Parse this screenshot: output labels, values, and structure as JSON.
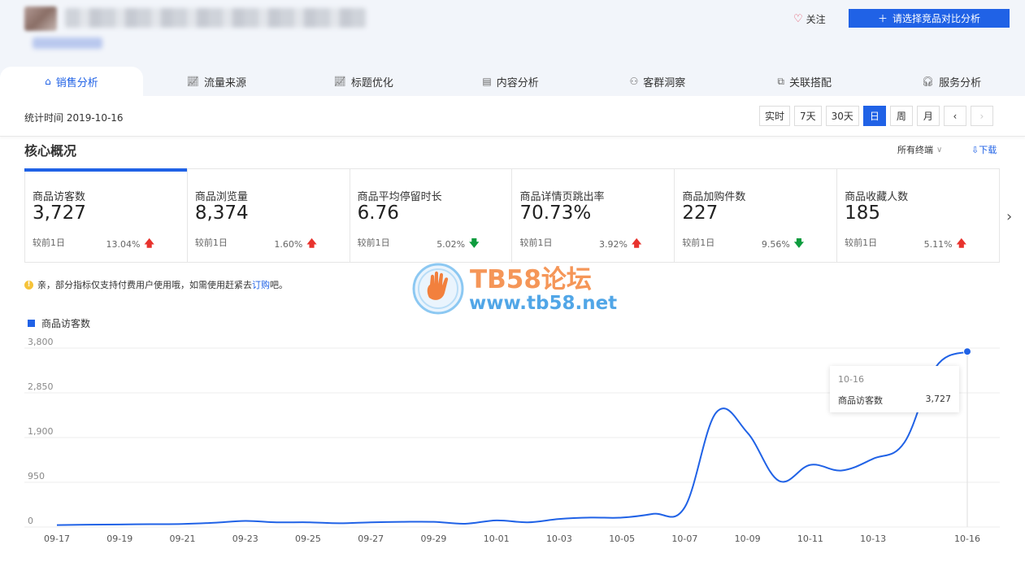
{
  "header": {
    "follow_label": "关注",
    "compare_button": "请选择竞品对比分析"
  },
  "tabs": [
    {
      "label": "销售分析",
      "icon": "bag-icon"
    },
    {
      "label": "流量来源",
      "icon": "line-chart-icon"
    },
    {
      "label": "标题优化",
      "icon": "line-chart-icon"
    },
    {
      "label": "内容分析",
      "icon": "document-icon"
    },
    {
      "label": "客群洞察",
      "icon": "users-icon"
    },
    {
      "label": "关联搭配",
      "icon": "link-icon"
    },
    {
      "label": "服务分析",
      "icon": "headset-icon"
    }
  ],
  "datebar": {
    "stat_time": "统计时间 2019-10-16",
    "ranges": [
      "实时",
      "7天",
      "30天",
      "日",
      "周",
      "月"
    ],
    "active_range": "日"
  },
  "core": {
    "title": "核心概况",
    "terminal": "所有终端",
    "download": "下载",
    "cards": [
      {
        "label": "商品访客数",
        "value": "3,727",
        "compare": "较前1日",
        "pct": "13.04%",
        "trend": "up"
      },
      {
        "label": "商品浏览量",
        "value": "8,374",
        "compare": "较前1日",
        "pct": "1.60%",
        "trend": "up"
      },
      {
        "label": "商品平均停留时长",
        "value": "6.76",
        "compare": "较前1日",
        "pct": "5.02%",
        "trend": "down"
      },
      {
        "label": "商品详情页跳出率",
        "value": "70.73%",
        "compare": "较前1日",
        "pct": "3.92%",
        "trend": "up"
      },
      {
        "label": "商品加购件数",
        "value": "227",
        "compare": "较前1日",
        "pct": "9.56%",
        "trend": "down"
      },
      {
        "label": "商品收藏人数",
        "value": "185",
        "compare": "较前1日",
        "pct": "5.11%",
        "trend": "up"
      }
    ]
  },
  "notice": {
    "text": "亲，部分指标仅支持付费用户使用哦，如需使用赶紧去",
    "link": "订购",
    "suffix": "吧。"
  },
  "watermark": {
    "line1": "TB58论坛",
    "line2": "www.tb58.net"
  },
  "colors": {
    "accent": "#2062e6",
    "up": "#e8322d",
    "down": "#0e9c3e"
  },
  "chart_data": {
    "type": "line",
    "series": [
      {
        "name": "商品访客数",
        "x": [
          "09-17",
          "09-18",
          "09-19",
          "09-20",
          "09-21",
          "09-22",
          "09-23",
          "09-24",
          "09-25",
          "09-26",
          "09-27",
          "09-28",
          "09-29",
          "09-30",
          "10-01",
          "10-02",
          "10-03",
          "10-04",
          "10-05",
          "10-06",
          "10-07",
          "10-08",
          "10-09",
          "10-10",
          "10-11",
          "10-12",
          "10-13",
          "10-14",
          "10-15",
          "10-16"
        ],
        "values": [
          40,
          50,
          55,
          60,
          65,
          90,
          130,
          100,
          100,
          80,
          100,
          110,
          110,
          70,
          140,
          100,
          170,
          200,
          200,
          280,
          420,
          2430,
          2000,
          980,
          1320,
          1200,
          1450,
          1800,
          3400,
          3727
        ]
      }
    ],
    "x_tick_labels": [
      "09-17",
      "09-19",
      "09-21",
      "09-23",
      "09-25",
      "09-27",
      "09-29",
      "10-01",
      "10-03",
      "10-05",
      "10-07",
      "10-09",
      "10-11",
      "10-13",
      "10-16"
    ],
    "y_ticks": [
      0,
      950,
      1900,
      2850,
      3800
    ],
    "ylim": [
      0,
      3800
    ],
    "grid": true,
    "legend": "top-left",
    "tooltip": {
      "date": "10-16",
      "name": "商品访客数",
      "value": "3,727"
    }
  }
}
